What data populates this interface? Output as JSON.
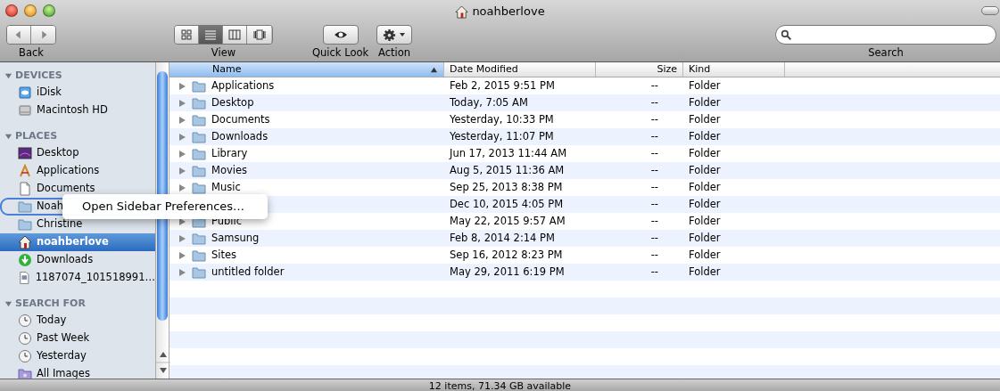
{
  "window": {
    "title": "noahberlove"
  },
  "toolbar": {
    "back": {
      "label": "Back"
    },
    "view": {
      "label": "View",
      "options": [
        {
          "kind": "icons",
          "selected": false
        },
        {
          "kind": "list",
          "selected": true
        },
        {
          "kind": "columns",
          "selected": false
        },
        {
          "kind": "coverflow",
          "selected": false
        }
      ]
    },
    "quick_look": {
      "label": "Quick Look"
    },
    "action": {
      "label": "Action"
    },
    "search": {
      "label": "Search"
    }
  },
  "sidebar": {
    "sections": [
      {
        "title": "DEVICES",
        "items": [
          {
            "label": "iDisk",
            "kind": "idisk",
            "selected": false,
            "outlined": false
          },
          {
            "label": "Macintosh HD",
            "kind": "harddrive",
            "selected": false,
            "outlined": false
          }
        ]
      },
      {
        "title": "PLACES",
        "items": [
          {
            "label": "Desktop",
            "kind": "desktop",
            "selected": false,
            "outlined": false
          },
          {
            "label": "Applications",
            "kind": "apps",
            "selected": false,
            "outlined": false
          },
          {
            "label": "Documents",
            "kind": "document",
            "selected": false,
            "outlined": false
          },
          {
            "label": "Noah",
            "kind": "folder",
            "selected": false,
            "outlined": true
          },
          {
            "label": "Christine",
            "kind": "folder",
            "selected": false,
            "outlined": false
          },
          {
            "label": "noahberlove",
            "kind": "home",
            "selected": true,
            "outlined": false
          },
          {
            "label": "Downloads",
            "kind": "download",
            "selected": false,
            "outlined": false
          },
          {
            "label": "1187074_101518991…",
            "kind": "file",
            "selected": false,
            "outlined": false
          }
        ]
      },
      {
        "title": "SEARCH FOR",
        "items": [
          {
            "label": "Today",
            "kind": "clock",
            "selected": false,
            "outlined": false
          },
          {
            "label": "Past Week",
            "kind": "clock",
            "selected": false,
            "outlined": false
          },
          {
            "label": "Yesterday",
            "kind": "clock",
            "selected": false,
            "outlined": false
          },
          {
            "label": "All Images",
            "kind": "smartfolder",
            "selected": false,
            "outlined": false
          }
        ]
      }
    ]
  },
  "context_menu": {
    "items": [
      "Open Sidebar Preferences…"
    ]
  },
  "table": {
    "columns": [
      {
        "label": "Name",
        "sorted": true
      },
      {
        "label": "Date Modified",
        "sorted": false
      },
      {
        "label": "Size",
        "sorted": false
      },
      {
        "label": "Kind",
        "sorted": false
      }
    ],
    "rows": [
      {
        "name": "Applications",
        "date": "Feb 2, 2015 9:51 PM",
        "size": "--",
        "kind": "Folder"
      },
      {
        "name": "Desktop",
        "date": "Today, 7:05 AM",
        "size": "--",
        "kind": "Folder"
      },
      {
        "name": "Documents",
        "date": "Yesterday, 10:33 PM",
        "size": "--",
        "kind": "Folder"
      },
      {
        "name": "Downloads",
        "date": "Yesterday, 11:07 PM",
        "size": "--",
        "kind": "Folder"
      },
      {
        "name": "Library",
        "date": "Jun 17, 2013 11:44 AM",
        "size": "--",
        "kind": "Folder"
      },
      {
        "name": "Movies",
        "date": "Aug 5, 2015 11:36 AM",
        "size": "--",
        "kind": "Folder"
      },
      {
        "name": "Music",
        "date": "Sep 25, 2013 8:38 PM",
        "size": "--",
        "kind": "Folder"
      },
      {
        "date": "Dec 10, 2015 4:05 PM",
        "size": "--",
        "kind": "Folder"
      },
      {
        "name": "Public",
        "date": "May 22, 2015 9:57 AM",
        "size": "--",
        "kind": "Folder"
      },
      {
        "name": "Samsung",
        "date": "Feb 8, 2014 2:14 PM",
        "size": "--",
        "kind": "Folder"
      },
      {
        "name": "Sites",
        "date": "Sep 16, 2012 8:23 PM",
        "size": "--",
        "kind": "Folder"
      },
      {
        "name": "untitled folder",
        "date": "May 29, 2011 6:19 PM",
        "size": "--",
        "kind": "Folder"
      }
    ]
  },
  "status_bar": {
    "text": "12 items, 71.34 GB available"
  }
}
